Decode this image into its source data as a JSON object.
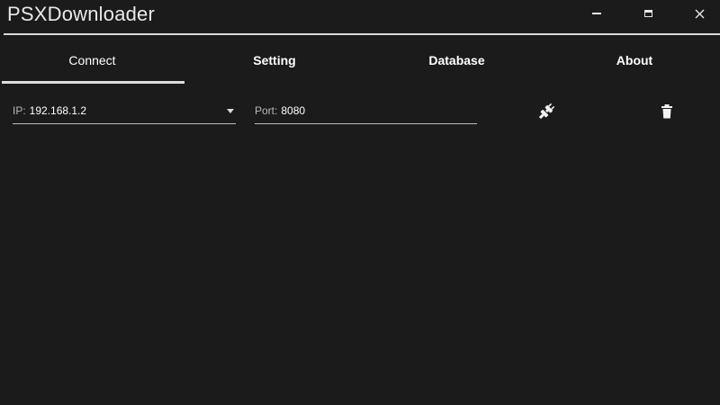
{
  "window": {
    "title": "PSXDownloader"
  },
  "tabs": [
    {
      "label": "Connect",
      "active": true
    },
    {
      "label": "Setting",
      "active": false
    },
    {
      "label": "Database",
      "active": false
    },
    {
      "label": "About",
      "active": false
    }
  ],
  "connection": {
    "ip_label": "IP:",
    "ip_value": "192.168.1.2",
    "port_label": "Port:",
    "port_value": "8080"
  },
  "icons": {
    "connect": "plug-icon",
    "delete": "trash-icon",
    "minimize": "minimize-icon",
    "maximize": "maximize-icon",
    "close": "close-icon"
  },
  "colors": {
    "background": "#1b1b1c",
    "text": "#ffffff",
    "muted_text": "#b8b8b8",
    "accent_line": "#dedede"
  }
}
